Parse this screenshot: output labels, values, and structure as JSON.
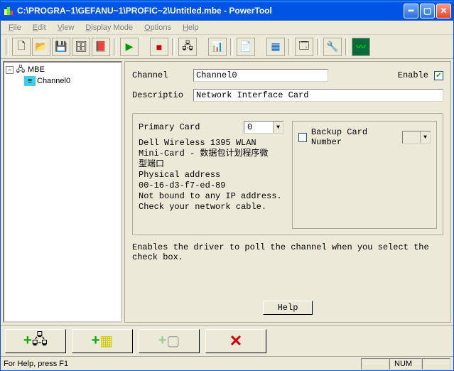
{
  "window": {
    "title": "C:\\PROGRA~1\\GEFANU~1\\PROFIC~2\\Untitled.mbe - PowerTool"
  },
  "menu": {
    "file": "File",
    "edit": "Edit",
    "view": "View",
    "display": "Display Mode",
    "options": "Options",
    "help": "Help"
  },
  "tree": {
    "root": "MBE",
    "child": "Channel0"
  },
  "form": {
    "channel_label": "Channel",
    "channel_value": "Channel0",
    "enable_label": "Enable",
    "enable_checked": true,
    "description_label": "Descriptio",
    "description_value": "Network Interface Card",
    "primary_card_label": "Primary Card",
    "primary_card_value": "0",
    "backup_card_label": "Backup Card Number",
    "backup_card_value": "",
    "card_info": "Dell Wireless 1395 WLAN\nMini-Card - 数据包计划程序微\n型端口\nPhysical address\n00-16-d3-f7-ed-89\nNot bound to any IP address.\nCheck your network cable.",
    "hint": "Enables the driver to poll the channel when you select the check box.",
    "help_button": "Help"
  },
  "status": {
    "text": "For Help, press F1",
    "num": "NUM"
  },
  "icons": {
    "new": "🗋",
    "open": "📂",
    "save": "💾",
    "saveall": "🗄",
    "book": "📕",
    "play": "▶",
    "stop": "■",
    "net": "🖧",
    "chart": "📊",
    "doc": "📄",
    "grid": "▦",
    "form": "🗔",
    "wrench": "🔧",
    "wave": "〰",
    "add_device": "+🖧",
    "add_table": "+▦",
    "add_box": "+▢",
    "delete": "✕"
  }
}
